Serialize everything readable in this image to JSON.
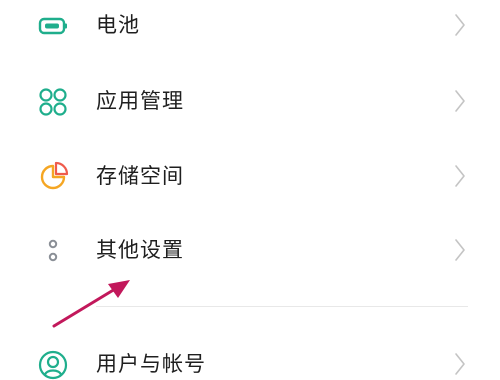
{
  "settings": {
    "items": [
      {
        "label": "电池",
        "icon": "battery-icon"
      },
      {
        "label": "应用管理",
        "icon": "apps-grid-icon"
      },
      {
        "label": "存储空间",
        "icon": "storage-pie-icon"
      },
      {
        "label": "其他设置",
        "icon": "more-dots-icon"
      },
      {
        "label": "用户与帐号",
        "icon": "user-account-icon"
      }
    ],
    "chevron_icon": "chevron-right-icon"
  },
  "colors": {
    "teal_icon": "#1fae8c",
    "storage_orange": "#f5a623",
    "storage_red": "#ef5b4c",
    "dots_gray": "#8a8f96",
    "text": "#1f1f1f",
    "chevron": "#c4c4c4",
    "annotation_arrow": "#c2185b"
  },
  "annotation": {
    "type": "arrow",
    "target": "其他设置"
  }
}
